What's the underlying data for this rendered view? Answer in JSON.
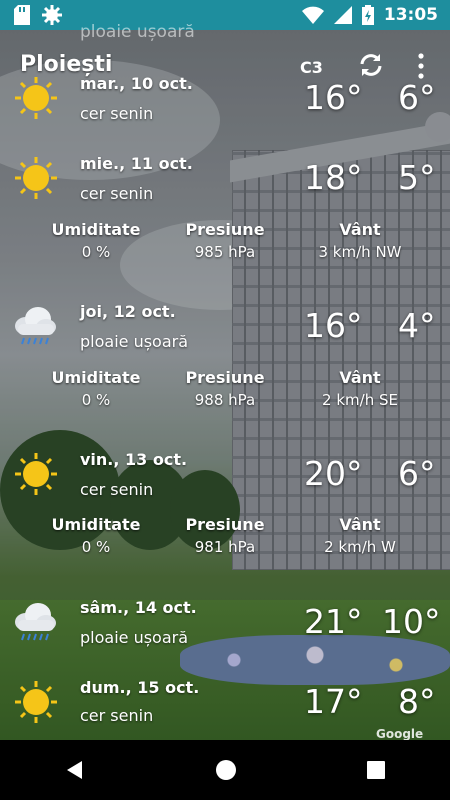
{
  "status_bar": {
    "time": "13:05",
    "left_icons": [
      "sd-card-icon",
      "gear-icon"
    ],
    "right_icons": [
      "wifi-icon",
      "signal-icon",
      "battery-charging-icon"
    ]
  },
  "app_bar": {
    "city": "Ploiești",
    "unit_label": "C3",
    "ghost_text": "ploaie ușoară"
  },
  "days": [
    {
      "date": "mar., 10 oct.",
      "condition": "cer senin",
      "icon": "sun-icon",
      "max": "16°",
      "min": "6°"
    },
    {
      "date": "mie., 11 oct.",
      "condition": "cer senin",
      "icon": "sun-icon",
      "max": "18°",
      "min": "5°",
      "details": {
        "humidity_label": "Umiditate",
        "humidity": "0 %",
        "pressure_label": "Presiune",
        "pressure": "985 hPa",
        "wind_label": "Vânt",
        "wind": "3 km/h NW"
      }
    },
    {
      "date": "joi, 12 oct.",
      "condition": "ploaie ușoară",
      "icon": "rain-cloud-icon",
      "max": "16°",
      "min": "4°",
      "details": {
        "humidity_label": "Umiditate",
        "humidity": "0 %",
        "pressure_label": "Presiune",
        "pressure": "988 hPa",
        "wind_label": "Vânt",
        "wind": "2 km/h SE"
      }
    },
    {
      "date": "vin., 13 oct.",
      "condition": "cer senin",
      "icon": "sun-icon",
      "max": "20°",
      "min": "6°",
      "details": {
        "humidity_label": "Umiditate",
        "humidity": "0 %",
        "pressure_label": "Presiune",
        "pressure": "981 hPa",
        "wind_label": "Vânt",
        "wind": "2 km/h W"
      }
    },
    {
      "date": "sâm., 14 oct.",
      "condition": "ploaie ușoară",
      "icon": "rain-cloud-icon",
      "max": "21°",
      "min": "10°"
    },
    {
      "date": "dum., 15 oct.",
      "condition": "cer senin",
      "icon": "sun-icon",
      "max": "17°",
      "min": "8°"
    }
  ],
  "attribution": "Google",
  "colors": {
    "status_bar": "#1e8e9e",
    "sun": "#f5c518",
    "navbar": "#000000"
  },
  "navbar_icons": [
    "back-icon",
    "home-icon",
    "recents-icon"
  ]
}
